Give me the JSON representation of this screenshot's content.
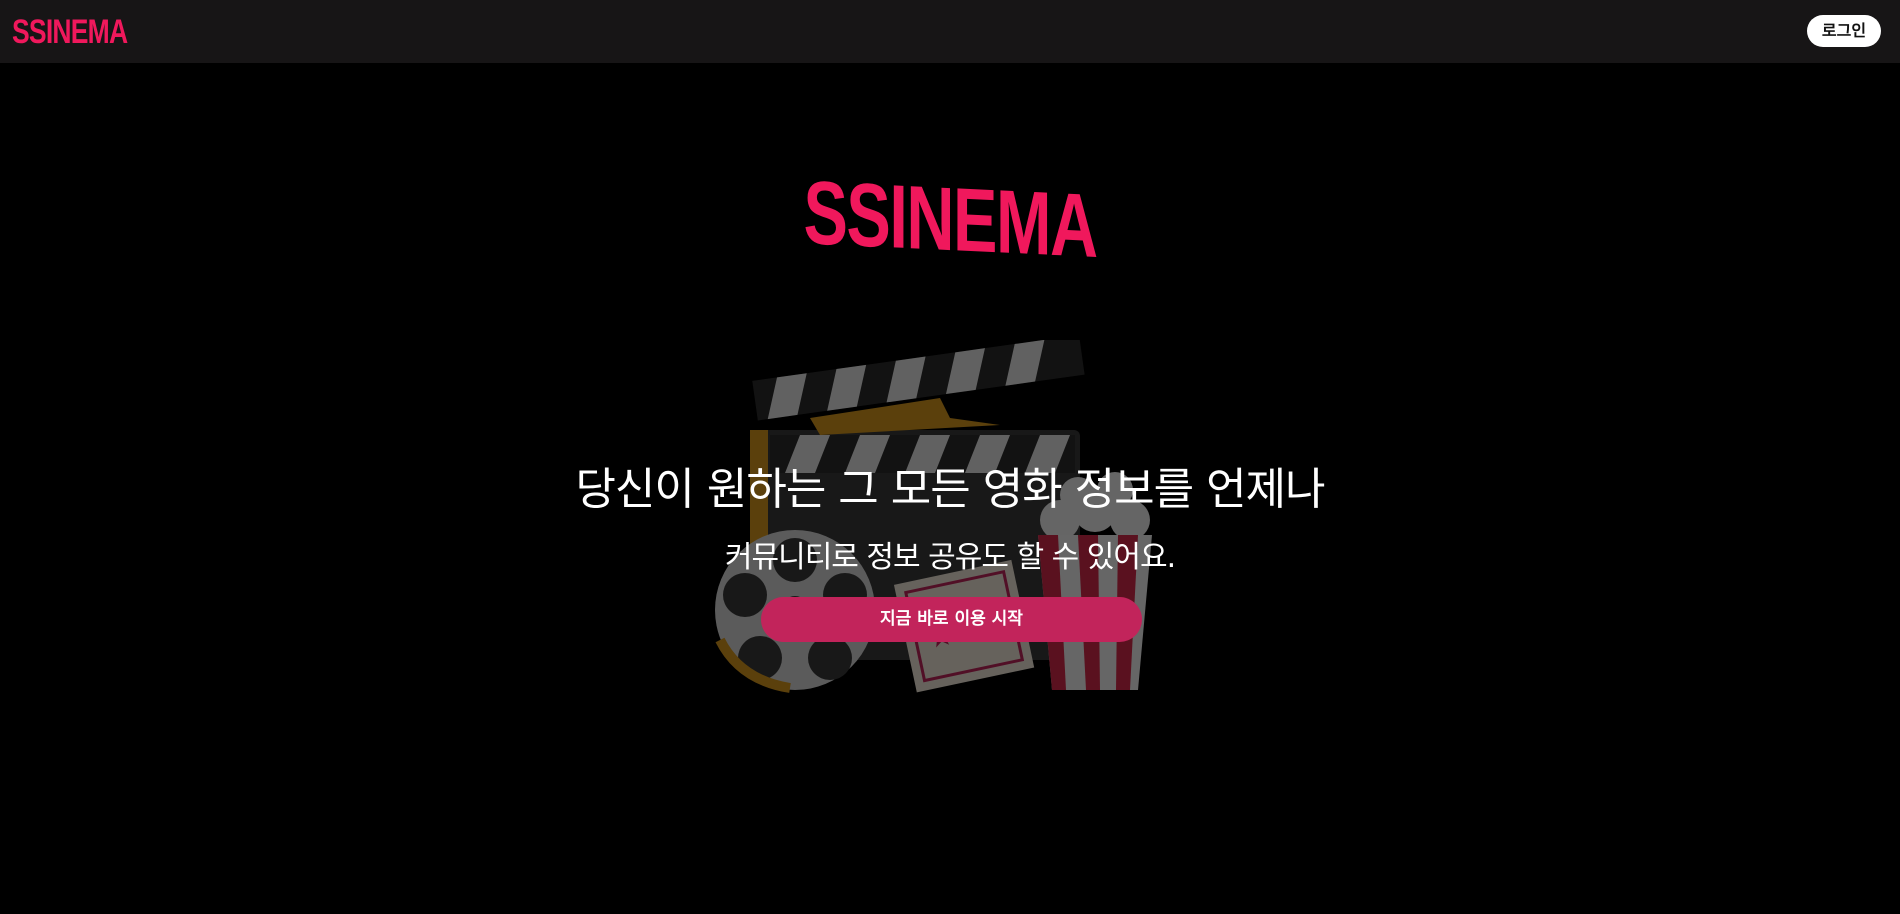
{
  "header": {
    "logo_text": "SSINEMA",
    "login_label": "로그인"
  },
  "hero": {
    "logo_text": "SSINEMA",
    "headline": "당신이 원하는 그 모든 영화 정보를 언제나",
    "subline": "커뮤니티로 정보 공유도 할 수 있어요.",
    "cta_label": "지금 바로 이용 시작",
    "illustration_icon": "movie-clapperboard-film-reel-ticket-popcorn"
  },
  "colors": {
    "brand": "#f0185c",
    "cta": "#c2245b",
    "topbar": "#171516",
    "background": "#000000"
  }
}
